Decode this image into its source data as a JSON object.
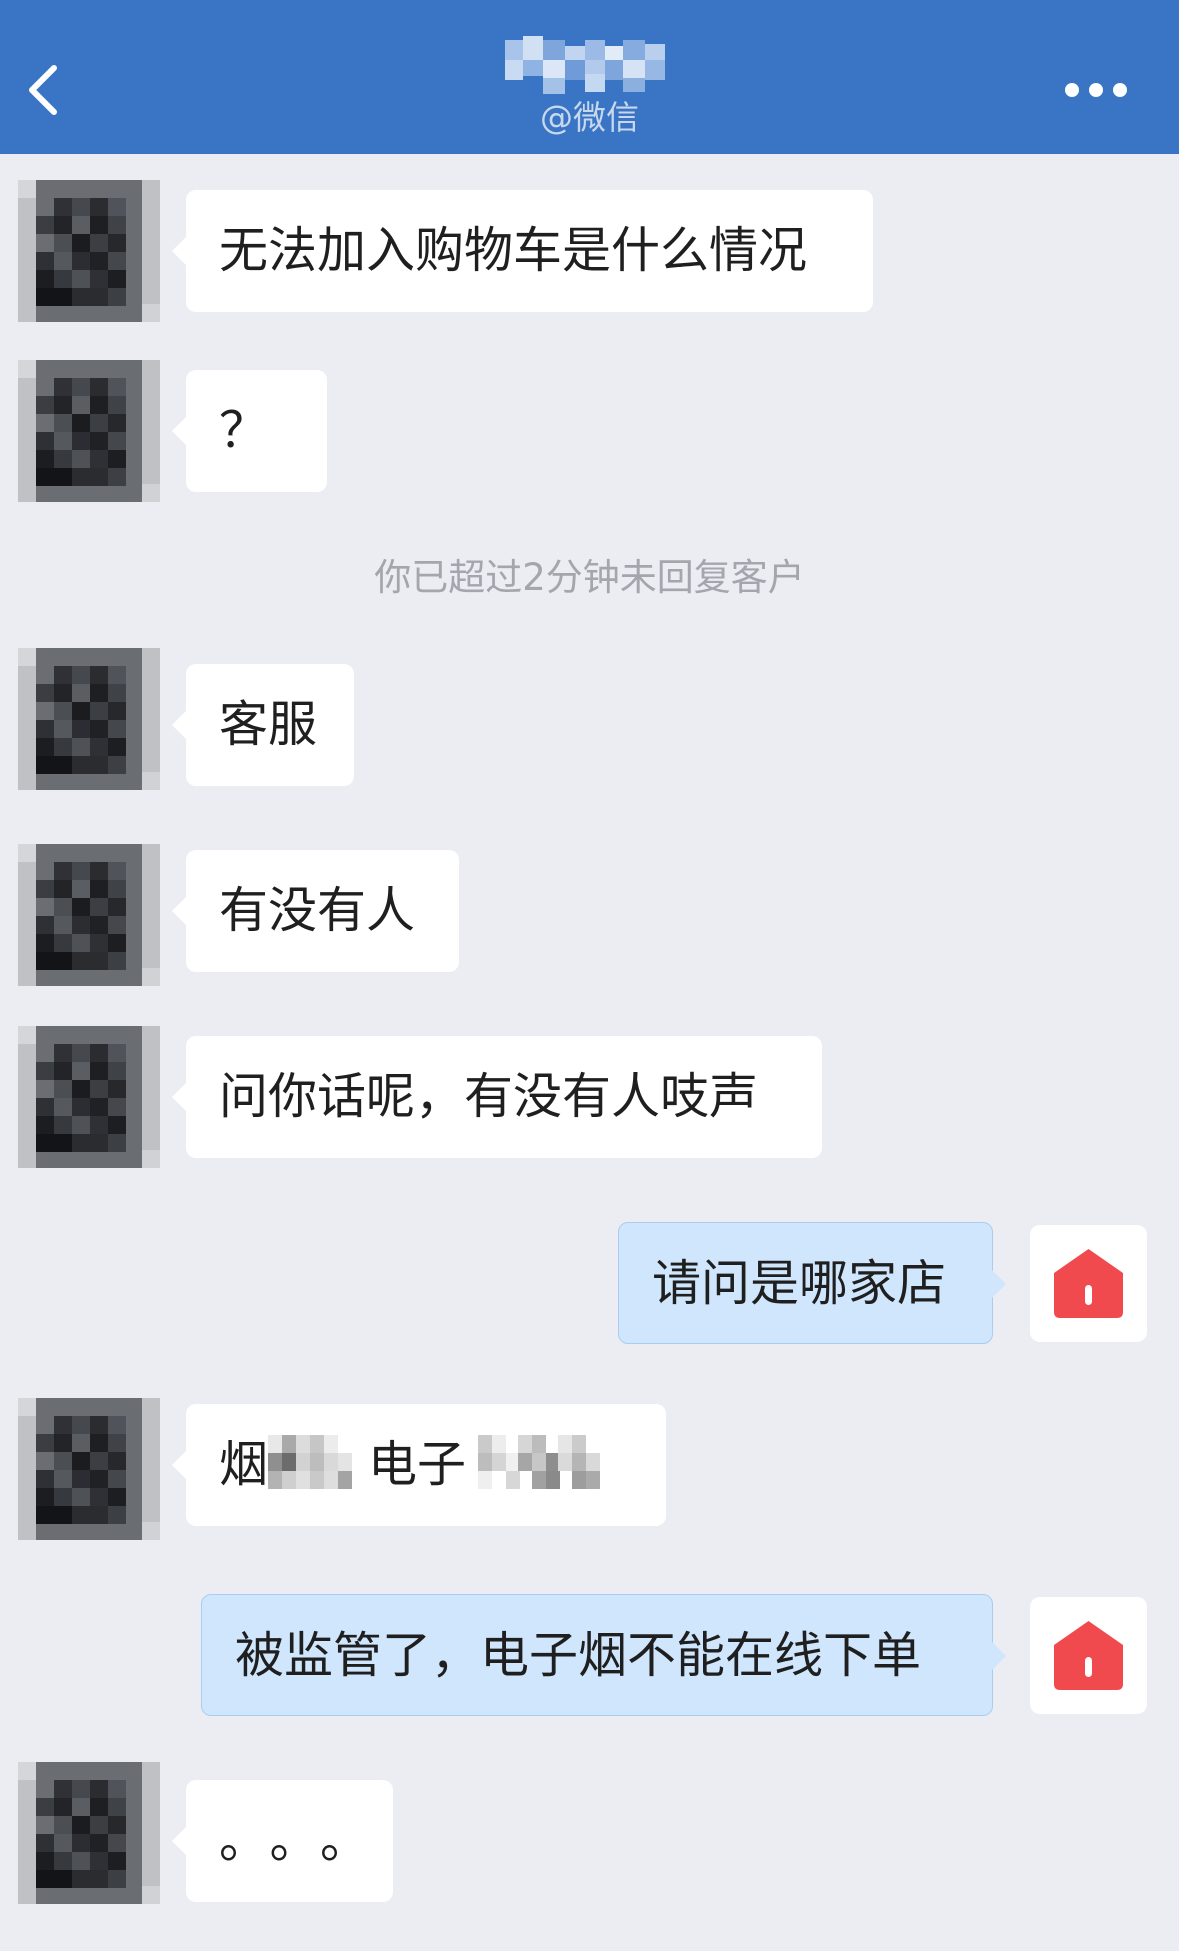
{
  "header": {
    "subtitle": "@微信",
    "back_icon": "chevron-left-icon",
    "more_icon": "more-dots-icon",
    "background": "#3a75c5"
  },
  "messages": [
    {
      "side": "in",
      "text": "无法加入购物车是什么情况"
    },
    {
      "side": "in",
      "text": "？"
    },
    {
      "side": "system",
      "text": "你已超过2分钟未回复客户"
    },
    {
      "side": "in",
      "text": "客服"
    },
    {
      "side": "in",
      "text": "有没有人"
    },
    {
      "side": "in",
      "text": "问你话呢，有没有人吱声"
    },
    {
      "side": "out",
      "text": "请问是哪家店"
    },
    {
      "side": "in",
      "text_parts": [
        "烟",
        "电子"
      ],
      "redacted": true
    },
    {
      "side": "out",
      "text": "被监管了，电子烟不能在线下单"
    },
    {
      "side": "in",
      "text": "。。。"
    }
  ],
  "colors": {
    "incoming_bubble": "#ffffff",
    "outgoing_bubble": "#cfe6fd",
    "shop_icon": "#f04a4e",
    "chat_background": "#ebedf2"
  }
}
